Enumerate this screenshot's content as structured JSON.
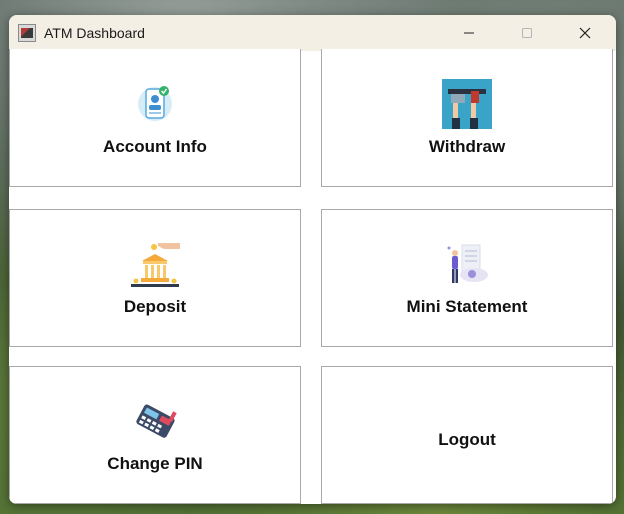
{
  "window": {
    "title": "ATM Dashboard",
    "controls": [
      "minimize",
      "maximize",
      "close"
    ]
  },
  "tiles": [
    {
      "label": "Account Info",
      "icon": "account-info-icon"
    },
    {
      "label": "Withdraw",
      "icon": "withdraw-icon"
    },
    {
      "label": "Deposit",
      "icon": "deposit-icon"
    },
    {
      "label": "Mini Statement",
      "icon": "mini-statement-icon"
    },
    {
      "label": "Change PIN",
      "icon": "change-pin-icon"
    },
    {
      "label": "Logout",
      "icon": ""
    }
  ],
  "colors": {
    "titlebar": "#f3efe4",
    "tile_border": "#a9a9a9",
    "label_text": "#111111"
  }
}
